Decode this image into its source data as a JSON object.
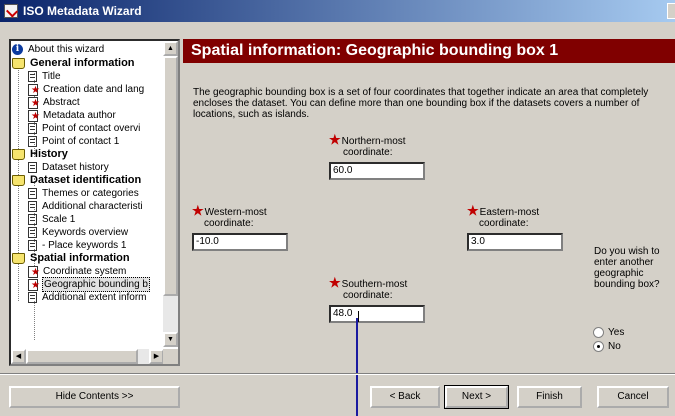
{
  "window": {
    "title": "ISO Metadata Wizard"
  },
  "tree": {
    "items": [
      {
        "label": "About this wizard",
        "icon": "info-icon",
        "bold": false
      },
      {
        "label": "General information",
        "icon": "book-icon",
        "bold": true
      },
      {
        "label": "Title",
        "icon": "document-icon",
        "bold": false
      },
      {
        "label": "Creation date and lang",
        "icon": "required-document-icon",
        "bold": false
      },
      {
        "label": "Abstract",
        "icon": "required-document-icon",
        "bold": false
      },
      {
        "label": "Metadata author",
        "icon": "required-document-icon",
        "bold": false
      },
      {
        "label": "Point of contact overvi",
        "icon": "document-icon",
        "bold": false
      },
      {
        "label": "Point of contact 1",
        "icon": "document-icon",
        "bold": false
      },
      {
        "label": "History",
        "icon": "book-icon",
        "bold": true
      },
      {
        "label": "Dataset history",
        "icon": "document-icon",
        "bold": false
      },
      {
        "label": "Dataset identification",
        "icon": "book-icon",
        "bold": true
      },
      {
        "label": "Themes or categories",
        "icon": "document-icon",
        "bold": false
      },
      {
        "label": "Additional characteristi",
        "icon": "document-icon",
        "bold": false
      },
      {
        "label": "Scale 1",
        "icon": "document-icon",
        "bold": false
      },
      {
        "label": "Keywords overview",
        "icon": "document-icon",
        "bold": false
      },
      {
        "label": "- Place keywords 1",
        "icon": "document-icon",
        "bold": false
      },
      {
        "label": "Spatial information",
        "icon": "book-icon",
        "bold": true
      },
      {
        "label": "Coordinate system",
        "icon": "required-document-icon",
        "bold": false
      },
      {
        "label": "Geographic bounding b",
        "icon": "required-document-icon",
        "bold": false,
        "selected": true
      },
      {
        "label": "Additional extent inform",
        "icon": "document-icon",
        "bold": false
      }
    ]
  },
  "main": {
    "heading": "Spatial information: Geographic bounding box 1",
    "description": "The geographic bounding box is a set of four coordinates that together indicate an area that completely encloses the dataset. You can define more than one bounding box if the datasets covers a number of locations, such as islands.",
    "north": {
      "label_1": "Northern-most",
      "label_2": "coordinate:",
      "value": "60.0"
    },
    "west": {
      "label_1": "Western-most",
      "label_2": "coordinate:",
      "value": "-10.0"
    },
    "east": {
      "label_1": "Eastern-most",
      "label_2": "coordinate:",
      "value": "3.0"
    },
    "south": {
      "label_1": "Southern-most",
      "label_2": "coordinate:",
      "value": "48.0"
    },
    "another_box": {
      "question": "Do you wish to enter another geographic bounding box?",
      "yes_label": "Yes",
      "no_label": "No",
      "selected": "No"
    }
  },
  "buttons": {
    "hide_contents": "Hide Contents >>",
    "back": "< Back",
    "next": "Next >",
    "finish": "Finish",
    "cancel": "Cancel"
  },
  "colors": {
    "title_bar": "#0a246a",
    "header": "#800000",
    "required_star": "#c00000"
  }
}
